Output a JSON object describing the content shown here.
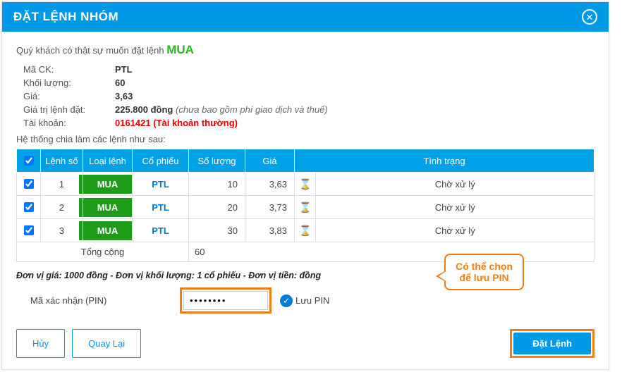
{
  "modal": {
    "title": "ĐẶT LỆNH NHÓM",
    "confirm_prefix": "Quý khách có thật sự muốn đặt lệnh ",
    "action_word": "MUA"
  },
  "info": {
    "symbol_label": "Mã CK:",
    "symbol_value": "PTL",
    "qty_label": "Khối lượng:",
    "qty_value": "60",
    "price_label": "Giá:",
    "price_value": "3,63",
    "total_label": "Giá trị lệnh đặt:",
    "total_value": "225.800 đồng",
    "total_note": "(chưa bao gồm phí giao dịch và thuế)",
    "account_label": "Tài khoản:",
    "account_value": "0161421 (Tài khoản thường)"
  },
  "sub_heading": "Hệ thống chia làm các lệnh như sau:",
  "headers": {
    "no": "Lệnh số",
    "type": "Loại lệnh",
    "sym": "Cổ phiếu",
    "qty": "Số lượng",
    "price": "Giá",
    "status": "Tình trạng"
  },
  "rows": [
    {
      "no": "1",
      "type": "MUA",
      "sym": "PTL",
      "qty": "10",
      "price": "3,63",
      "status": "Chờ xử lý"
    },
    {
      "no": "2",
      "type": "MUA",
      "sym": "PTL",
      "qty": "20",
      "price": "3,73",
      "status": "Chờ xử lý"
    },
    {
      "no": "3",
      "type": "MUA",
      "sym": "PTL",
      "qty": "30",
      "price": "3,83",
      "status": "Chờ xử lý"
    }
  ],
  "totals": {
    "label": "Tổng cộng",
    "qty": "60"
  },
  "unit_note": "Đơn vị giá: 1000 đồng - Đơn vị khối lượng: 1 cổ phiếu - Đơn vị tiền: đồng",
  "pin": {
    "label": "Mã xác nhận (PIN)",
    "value": "••••••••",
    "save_label": "Lưu PIN"
  },
  "callout": {
    "line1": "Có thể chọn",
    "line2": "để lưu PIN"
  },
  "buttons": {
    "cancel": "Hủy",
    "back": "Quay Lại",
    "submit": "Đặt Lệnh"
  }
}
